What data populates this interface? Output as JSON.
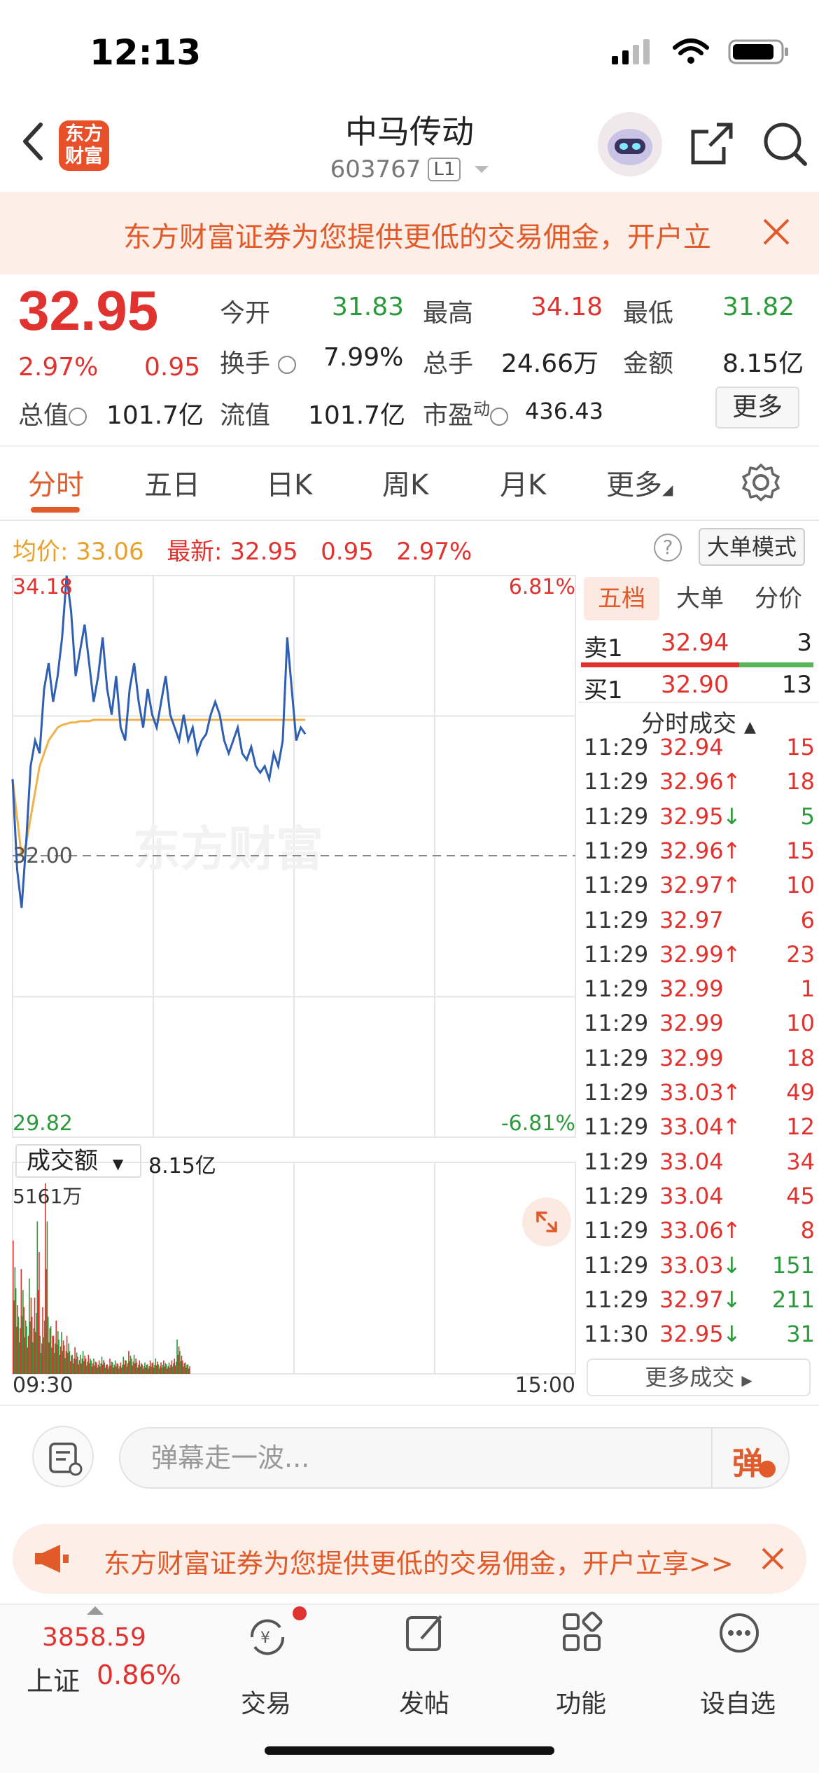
{
  "status": {
    "time": "12:13"
  },
  "nav": {
    "logo_line1": "东方",
    "logo_line2": "财富",
    "stock_name": "中马传动",
    "stock_code": "603767",
    "level_badge": "L1"
  },
  "banner": {
    "text": "东方财富证券为您提供更低的交易佣金，开户立"
  },
  "quote": {
    "price": "32.95",
    "change_pct": "2.97%",
    "change": "0.95",
    "open_label": "今开",
    "open": "31.83",
    "high_label": "最高",
    "high": "34.18",
    "low_label": "最低",
    "low": "31.82",
    "turnover_label": "换手",
    "turnover": "7.99%",
    "volume_label": "总手",
    "volume": "24.66万",
    "amount_label": "金额",
    "amount": "8.15亿",
    "mktcap_label": "总值",
    "mktcap": "101.7亿",
    "float_label": "流值",
    "float": "101.7亿",
    "pe_label": "市盈",
    "pe_sup": "动",
    "pe": "436.43",
    "more_label": "更多"
  },
  "tabs": [
    {
      "label": "分时",
      "active": true
    },
    {
      "label": "五日"
    },
    {
      "label": "日K"
    },
    {
      "label": "周K"
    },
    {
      "label": "月K"
    },
    {
      "label": "更多"
    }
  ],
  "avg_row": {
    "avg_label": "均价:",
    "avg_value": "33.06",
    "latest_label": "最新:",
    "latest_value": "32.95",
    "latest_change": "0.95",
    "latest_pct": "2.97%",
    "big_order_label": "大单模式",
    "help": "?"
  },
  "chart_axis": {
    "price_top": "34.18",
    "price_mid": "32.00",
    "price_bottom": "29.82",
    "pct_top": "6.81%",
    "pct_bottom": "-6.81%",
    "vol_top": "5161万",
    "time_start": "09:30",
    "time_end": "15:00",
    "watermark": "东方财富"
  },
  "volume_selector": {
    "label": "成交额",
    "value": "8.15亿"
  },
  "order_book": {
    "tabs": [
      "五档",
      "大单",
      "分价"
    ],
    "sell1": {
      "label": "卖1",
      "price": "32.94",
      "qty": "3"
    },
    "buy1": {
      "label": "买1",
      "price": "32.90",
      "qty": "13"
    },
    "trades_header": "分时成交",
    "trades": [
      {
        "time": "11:29",
        "price": "32.94",
        "arrow": "",
        "qty": "15",
        "dir": "red"
      },
      {
        "time": "11:29",
        "price": "32.96",
        "arrow": "↑",
        "qty": "18",
        "dir": "red"
      },
      {
        "time": "11:29",
        "price": "32.95",
        "arrow": "↓",
        "qty": "5",
        "dir": "green"
      },
      {
        "time": "11:29",
        "price": "32.96",
        "arrow": "↑",
        "qty": "15",
        "dir": "red"
      },
      {
        "time": "11:29",
        "price": "32.97",
        "arrow": "↑",
        "qty": "10",
        "dir": "red"
      },
      {
        "time": "11:29",
        "price": "32.97",
        "arrow": "",
        "qty": "6",
        "dir": "red"
      },
      {
        "time": "11:29",
        "price": "32.99",
        "arrow": "↑",
        "qty": "23",
        "dir": "red"
      },
      {
        "time": "11:29",
        "price": "32.99",
        "arrow": "",
        "qty": "1",
        "dir": "red"
      },
      {
        "time": "11:29",
        "price": "32.99",
        "arrow": "",
        "qty": "10",
        "dir": "red"
      },
      {
        "time": "11:29",
        "price": "32.99",
        "arrow": "",
        "qty": "18",
        "dir": "red"
      },
      {
        "time": "11:29",
        "price": "33.03",
        "arrow": "↑",
        "qty": "49",
        "dir": "red"
      },
      {
        "time": "11:29",
        "price": "33.04",
        "arrow": "↑",
        "qty": "12",
        "dir": "red"
      },
      {
        "time": "11:29",
        "price": "33.04",
        "arrow": "",
        "qty": "34",
        "dir": "red"
      },
      {
        "time": "11:29",
        "price": "33.04",
        "arrow": "",
        "qty": "45",
        "dir": "red"
      },
      {
        "time": "11:29",
        "price": "33.06",
        "arrow": "↑",
        "qty": "8",
        "dir": "red"
      },
      {
        "time": "11:29",
        "price": "33.03",
        "arrow": "↓",
        "qty": "151",
        "dir": "green"
      },
      {
        "time": "11:29",
        "price": "32.97",
        "arrow": "↓",
        "qty": "211",
        "dir": "green"
      },
      {
        "time": "11:30",
        "price": "32.95",
        "arrow": "↓",
        "qty": "31",
        "dir": "green"
      }
    ],
    "more_trades": "更多成交"
  },
  "comment": {
    "placeholder": "弹幕走一波...",
    "danmu_label": "弹"
  },
  "banner2": {
    "text": "东方财富证券为您提供更低的交易佣金，开户立享>>"
  },
  "tabbar": {
    "index_value": "3858.59",
    "index_name": "上证",
    "index_pct": "0.86%",
    "items": [
      "交易",
      "发帖",
      "功能",
      "设自选"
    ]
  },
  "colors": {
    "up": "#e0322e",
    "down": "#2a9a3a",
    "accent": "#e05a2a",
    "avg_line": "#f0b24a",
    "price_line": "#2f5fb3"
  },
  "chart_data": {
    "type": "line",
    "title": "",
    "xlabel": "",
    "ylabel": "",
    "ylim": [
      29.82,
      34.18
    ],
    "x_range": [
      "09:30",
      "15:00"
    ],
    "prev_close": 32.0,
    "series": [
      {
        "values": [
          32.6,
          31.9,
          31.6,
          32.1,
          32.7,
          32.9,
          32.8,
          33.3,
          33.5,
          33.2,
          33.4,
          33.7,
          34.18,
          33.9,
          33.4,
          33.6,
          33.8,
          33.5,
          33.2,
          33.4,
          33.7,
          33.3,
          33.1,
          33.4,
          33.0,
          32.9,
          33.3,
          33.5,
          33.2,
          33.0,
          33.3,
          33.1,
          33.0,
          33.2,
          33.4,
          33.1,
          33.0,
          32.9,
          33.1,
          32.9,
          33.0,
          32.8,
          32.9,
          32.95,
          33.1,
          33.2,
          33.1,
          32.9,
          32.8,
          32.9,
          33.0,
          32.8,
          32.75,
          32.85,
          32.7,
          32.65,
          32.7,
          32.6,
          32.8,
          32.7,
          32.9,
          33.7,
          33.3,
          32.9,
          33.0,
          32.95
        ]
      },
      {
        "values": [
          32.6,
          32.3,
          32.0,
          32.1,
          32.3,
          32.5,
          32.7,
          32.8,
          32.9,
          32.95,
          33.0,
          33.02,
          33.03,
          33.04,
          33.04,
          33.05,
          33.05,
          33.05,
          33.06,
          33.06,
          33.06,
          33.06,
          33.06,
          33.06,
          33.06,
          33.06,
          33.06,
          33.06,
          33.06,
          33.06,
          33.06,
          33.06,
          33.06,
          33.06,
          33.06,
          33.06,
          33.06,
          33.06,
          33.06,
          33.06,
          33.06,
          33.06,
          33.06,
          33.06,
          33.06,
          33.06,
          33.06,
          33.06,
          33.06,
          33.06,
          33.06,
          33.06,
          33.06,
          33.06,
          33.06,
          33.06,
          33.06,
          33.06,
          33.06,
          33.06,
          33.06,
          33.06,
          33.06,
          33.06,
          33.06,
          33.06
        ]
      }
    ],
    "volume_max_label": "5161万",
    "volume": [
      0.7,
      0.45,
      0.3,
      0.55,
      0.35,
      0.25,
      0.5,
      0.3,
      0.4,
      0.8,
      0.2,
      0.35,
      1.0,
      0.3,
      0.25,
      0.2,
      0.28,
      0.18,
      0.22,
      0.15,
      0.2,
      0.12,
      0.1,
      0.14,
      0.09,
      0.1,
      0.12,
      0.08,
      0.1,
      0.07,
      0.08,
      0.06,
      0.07,
      0.09,
      0.06,
      0.05,
      0.08,
      0.06,
      0.07,
      0.05,
      0.06,
      0.09,
      0.07,
      0.12,
      0.08,
      0.1,
      0.06,
      0.07,
      0.05,
      0.06,
      0.05,
      0.07,
      0.06,
      0.08,
      0.05,
      0.06,
      0.07,
      0.05,
      0.06,
      0.07,
      0.08,
      0.18,
      0.12,
      0.07,
      0.06,
      0.05
    ]
  }
}
